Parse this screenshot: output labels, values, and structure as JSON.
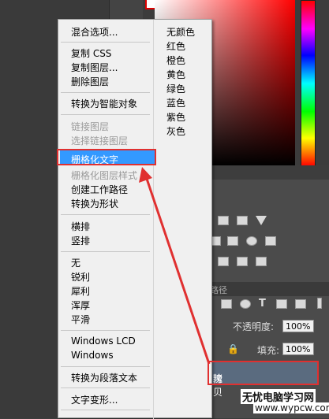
{
  "context_menu": {
    "main_items": [
      {
        "label": "混合选项...",
        "disabled": false
      },
      {
        "label": "复制 CSS",
        "disabled": false
      },
      {
        "label": "复制图层...",
        "disabled": false
      },
      {
        "label": "删除图层",
        "disabled": false
      },
      {
        "label": "转换为智能对象",
        "disabled": false
      },
      {
        "label": "链接图层",
        "disabled": true
      },
      {
        "label": "选择链接图层",
        "disabled": true
      },
      {
        "label": "栅格化文字",
        "disabled": false,
        "highlighted": true
      },
      {
        "label": "栅格化图层样式",
        "disabled": true
      },
      {
        "label": "创建工作路径",
        "disabled": false
      },
      {
        "label": "转换为形状",
        "disabled": false
      },
      {
        "label": "横排",
        "disabled": false
      },
      {
        "label": "竖排",
        "disabled": false
      },
      {
        "label": "无",
        "disabled": false
      },
      {
        "label": "锐利",
        "disabled": false
      },
      {
        "label": "犀利",
        "disabled": false
      },
      {
        "label": "浑厚",
        "disabled": false
      },
      {
        "label": "平滑",
        "disabled": false
      },
      {
        "label": "Windows LCD",
        "disabled": false
      },
      {
        "label": "Windows",
        "disabled": false
      },
      {
        "label": "转换为段落文本",
        "disabled": false
      },
      {
        "label": "文字变形...",
        "disabled": false
      }
    ],
    "color_items": [
      "无颜色",
      "红色",
      "橙色",
      "黄色",
      "绿色",
      "蓝色",
      "紫色",
      "灰色"
    ]
  },
  "layers_panel": {
    "tab_label": "路径",
    "opacity_label": "不透明度:",
    "opacity_value": "100%",
    "fill_label": "填充:",
    "fill_value": "100%",
    "selected_layer_name": "拷贝",
    "selected_layer_prefix": "瑰"
  },
  "watermark": {
    "line1": "无忧电脑学习网",
    "line2": "www.wypcw.com"
  },
  "colors": {
    "highlight": "#3399ff",
    "annotation_red": "#e03030",
    "menu_bg": "#f0f0f0"
  }
}
